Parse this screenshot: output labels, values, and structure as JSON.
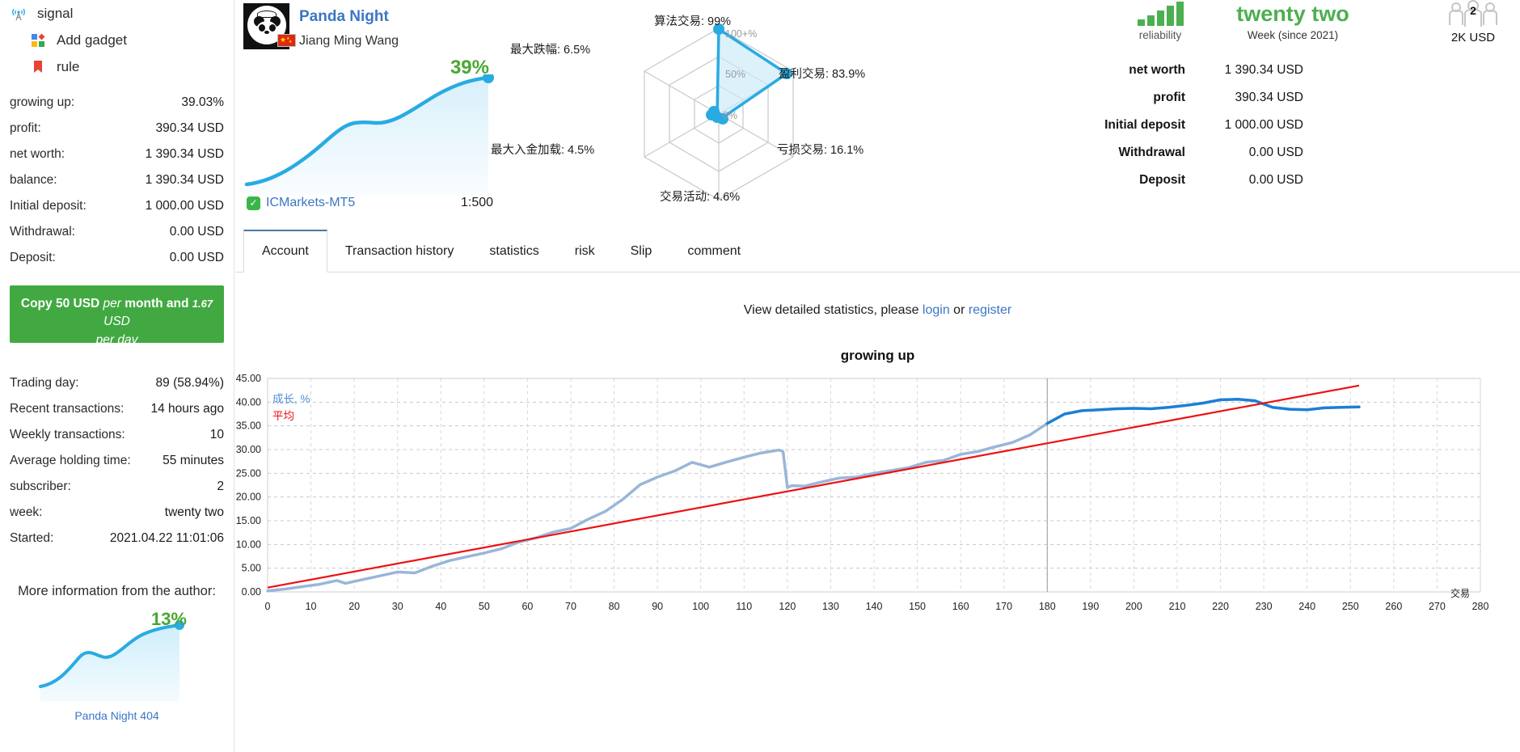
{
  "sidebar": {
    "nav": [
      {
        "label": "signal",
        "icon": "broadcast-icon"
      },
      {
        "label": "Add gadget",
        "icon": "widgets-icon"
      },
      {
        "label": "rule",
        "icon": "bookmark-icon"
      }
    ],
    "stats_primary": [
      {
        "label": "growing up:",
        "value": "39.03%"
      },
      {
        "label": "profit:",
        "value": "390.34 USD"
      },
      {
        "label": "net worth:",
        "value": "1 390.34 USD"
      },
      {
        "label": "balance:",
        "value": "1 390.34 USD"
      },
      {
        "label": "Initial deposit:",
        "value": "1 000.00 USD"
      },
      {
        "label": "Withdrawal:",
        "value": "0.00 USD"
      },
      {
        "label": "Deposit:",
        "value": "0.00 USD"
      }
    ],
    "copy_box": {
      "prefix": "Copy 50 USD",
      "per": "per",
      "middle": "month and",
      "amount": "1.67",
      "currency": "USD",
      "per_day": "per day"
    },
    "stats_secondary": [
      {
        "label": "Trading day:",
        "value": "89 (58.94%)"
      },
      {
        "label": "Recent transactions:",
        "value": "14 hours ago"
      },
      {
        "label": "Weekly transactions:",
        "value": "10"
      },
      {
        "label": "Average holding time:",
        "value": "55 minutes"
      },
      {
        "label": "subscriber:",
        "value": "2"
      },
      {
        "label": "week:",
        "value": "twenty two"
      },
      {
        "label": "Started:",
        "value": "2021.04.22 11:01:06"
      }
    ],
    "more_info_title": "More information from the author:",
    "mini_chart": {
      "percent": "13%",
      "caption": "Panda Night 404"
    }
  },
  "profile": {
    "signal_name": "Panda Night",
    "author": "Jiang Ming Wang",
    "flag": "cn-flag-icon",
    "avatar": "panda-avatar"
  },
  "growth_card": {
    "percent": "39%",
    "broker": "ICMarkets-MT5",
    "leverage": "1:500",
    "verified_icon": "verified-check-icon"
  },
  "radar": {
    "axis_labels": [
      "100+%",
      "50%",
      "0%"
    ],
    "points": [
      {
        "name": "算法交易",
        "value": "99%",
        "full": "算法交易: 99%"
      },
      {
        "name": "盈利交易",
        "value": "83.9%",
        "full": "盈利交易: 83.9%"
      },
      {
        "name": "亏损交易",
        "value": "16.1%",
        "full": "亏损交易: 16.1%"
      },
      {
        "name": "交易活动",
        "value": "4.6%",
        "full": "交易活动: 4.6%"
      },
      {
        "name": "最大入金加载",
        "value": "4.5%",
        "full": "最大入金加载: 4.5%"
      },
      {
        "name": "最大跌幅",
        "value": "6.5%",
        "full": "最大跌幅: 6.5%"
      }
    ]
  },
  "badges": {
    "reliability_label": "reliability",
    "reliability_icon": "signal-bars-icon",
    "week_value": "twenty two",
    "week_label": "Week (since 2021)",
    "subscribers_count": "2",
    "subscribers_label": "2K USD",
    "subscribers_icon": "people-icon"
  },
  "right_stats": [
    {
      "label": "net worth",
      "value": "1 390.34 USD",
      "bar_pct": 100,
      "bar_style": "solid"
    },
    {
      "label": "profit",
      "value": "390.34 USD",
      "bar_pct": 28,
      "bar_style": "light"
    },
    {
      "label": "Initial deposit",
      "value": "1 000.00 USD",
      "bar_pct": 72,
      "bar_style": "solid"
    },
    {
      "label": "Withdrawal",
      "value": "0.00 USD",
      "bar_pct": 0,
      "bar_style": "tiny"
    },
    {
      "label": "Deposit",
      "value": "0.00 USD",
      "bar_pct": 0,
      "bar_style": "tiny"
    }
  ],
  "tabs": [
    {
      "label": "Account",
      "active": true
    },
    {
      "label": "Transaction history",
      "active": false
    },
    {
      "label": "statistics",
      "active": false
    },
    {
      "label": "risk",
      "active": false
    },
    {
      "label": "Slip",
      "active": false
    },
    {
      "label": "comment",
      "active": false
    }
  ],
  "notice": {
    "text_before": "View detailed statistics, please ",
    "login": "login",
    "or": " or ",
    "register": "register"
  },
  "chart_data": {
    "type": "line",
    "title": "growing up",
    "xlabel": "交易",
    "ylabel": "",
    "xlim": [
      0,
      280
    ],
    "ylim": [
      0,
      45
    ],
    "grid": true,
    "legend_position": "top-left",
    "xticks": [
      0,
      10,
      20,
      30,
      40,
      50,
      60,
      70,
      80,
      90,
      100,
      110,
      120,
      130,
      140,
      150,
      160,
      170,
      180,
      190,
      200,
      210,
      220,
      230,
      240,
      250,
      260,
      270,
      280
    ],
    "yticks": [
      "0.00",
      "5.00",
      "10.00",
      "15.00",
      "20.00",
      "25.00",
      "30.00",
      "35.00",
      "40.00",
      "45.00"
    ],
    "series": [
      {
        "name": "成长, %",
        "color": "#9ab6d8",
        "color_highlight": "#1b7fd4",
        "x": [
          0,
          4,
          8,
          12,
          16,
          18,
          22,
          26,
          30,
          34,
          38,
          42,
          46,
          50,
          54,
          58,
          62,
          66,
          70,
          74,
          78,
          82,
          86,
          90,
          94,
          98,
          102,
          106,
          110,
          114,
          118,
          119,
          120,
          121,
          124,
          128,
          132,
          136,
          140,
          144,
          148,
          152,
          156,
          160,
          164,
          168,
          172,
          176,
          180,
          184,
          188,
          192,
          196,
          200,
          204,
          208,
          212,
          216,
          220,
          224,
          228,
          232,
          236,
          240,
          244,
          248,
          252
        ],
        "y": [
          0.2,
          0.6,
          1.1,
          1.6,
          2.4,
          1.8,
          2.6,
          3.4,
          4.2,
          4.0,
          5.4,
          6.6,
          7.4,
          8.2,
          9.1,
          10.5,
          11.4,
          12.6,
          13.4,
          15.3,
          17.0,
          19.5,
          22.6,
          24.2,
          25.5,
          27.3,
          26.3,
          27.4,
          28.4,
          29.3,
          29.9,
          29.6,
          22.0,
          22.4,
          22.3,
          23.2,
          24.0,
          24.2,
          25.0,
          25.6,
          26.2,
          27.3,
          27.7,
          29.0,
          29.6,
          30.6,
          31.5,
          33.1,
          35.5,
          37.5,
          38.2,
          38.4,
          38.6,
          38.7,
          38.6,
          38.9,
          39.3,
          39.8,
          40.5,
          40.6,
          40.3,
          38.9,
          38.5,
          38.4,
          38.8,
          38.9,
          39.0
        ]
      },
      {
        "name": "平均",
        "color": "#ee1111",
        "x": [
          0,
          252
        ],
        "y": [
          0.9,
          43.5
        ]
      }
    ],
    "vertical_marker_x": 180
  }
}
